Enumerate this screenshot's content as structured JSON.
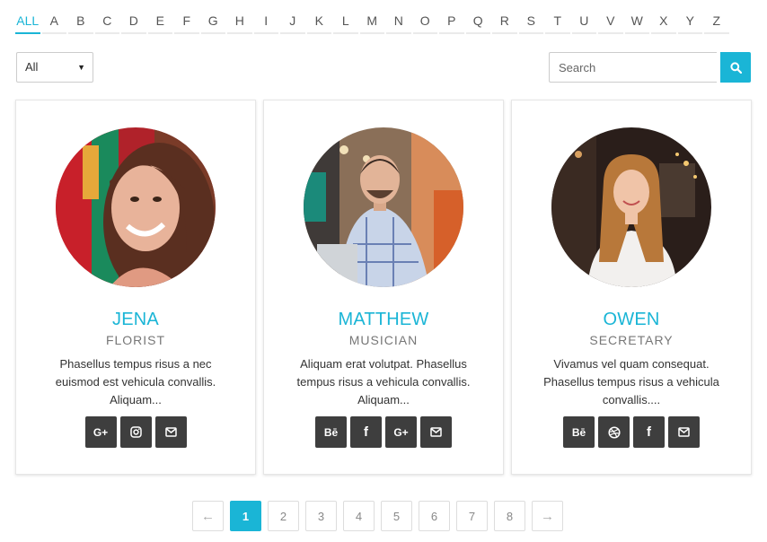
{
  "alphabet_filter": {
    "active": "ALL",
    "letters": [
      "ALL",
      "A",
      "B",
      "C",
      "D",
      "E",
      "F",
      "G",
      "H",
      "I",
      "J",
      "K",
      "L",
      "M",
      "N",
      "O",
      "P",
      "Q",
      "R",
      "S",
      "T",
      "U",
      "V",
      "W",
      "X",
      "Y",
      "Z"
    ]
  },
  "category_select": {
    "value": "All"
  },
  "search": {
    "placeholder": "Search",
    "value": "",
    "icon": "search-icon"
  },
  "members": [
    {
      "name": "JENA",
      "role": "FLORIST",
      "description": "Phasellus tempus risus a nec euismod est vehicula convallis. Aliquam...",
      "socials": [
        {
          "icon": "google-plus-icon",
          "glyph": "G+"
        },
        {
          "icon": "instagram-icon",
          "glyph": ""
        },
        {
          "icon": "email-icon",
          "glyph": ""
        }
      ]
    },
    {
      "name": "MATTHEW",
      "role": "MUSICIAN",
      "description": "Aliquam erat volutpat. Phasellus tempus risus a vehicula convallis. Aliquam...",
      "socials": [
        {
          "icon": "behance-icon",
          "glyph": "Bē"
        },
        {
          "icon": "facebook-icon",
          "glyph": "f"
        },
        {
          "icon": "google-plus-icon",
          "glyph": "G+"
        },
        {
          "icon": "email-icon",
          "glyph": ""
        }
      ]
    },
    {
      "name": "OWEN",
      "role": "SECRETARY",
      "description": "Vivamus vel quam consequat. Phasellus tempus risus a vehicula convallis....",
      "socials": [
        {
          "icon": "behance-icon",
          "glyph": "Bē"
        },
        {
          "icon": "dribbble-icon",
          "glyph": ""
        },
        {
          "icon": "facebook-icon",
          "glyph": "f"
        },
        {
          "icon": "email-icon",
          "glyph": ""
        }
      ]
    }
  ],
  "pagination": {
    "prev": "←",
    "next": "→",
    "pages": [
      "1",
      "2",
      "3",
      "4",
      "5",
      "6",
      "7",
      "8"
    ],
    "current": "1"
  },
  "colors": {
    "accent": "#1ab5d6",
    "social_bg": "#3e3e3e"
  }
}
